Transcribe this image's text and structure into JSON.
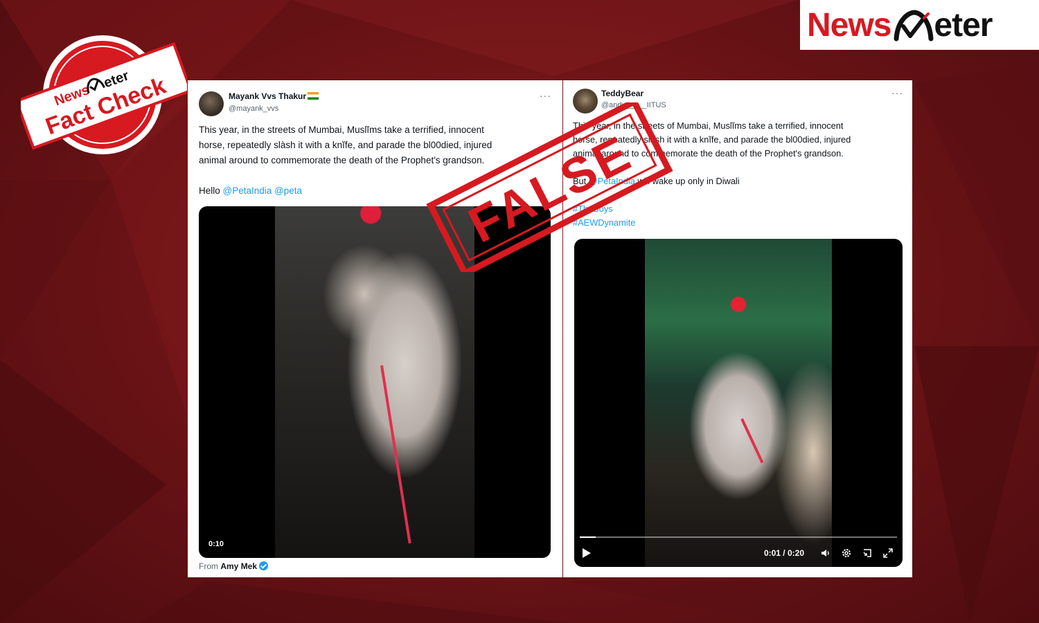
{
  "brand": {
    "name_part1": "News",
    "name_part2": "eter",
    "accent_color": "#d71920"
  },
  "fact_check_stamp": {
    "brand": "NewsMeter",
    "label": "Fact Check",
    "color": "#d71920"
  },
  "verdict_stamp": {
    "label": "FALSE",
    "color": "#d71920"
  },
  "tweet_left": {
    "author_name": "Mayank Vvs Thakur",
    "author_flag_icon": "india-flag-icon",
    "author_handle": "@mayank_vvs",
    "more_label": "···",
    "text_line1": "This year, in the streets of Mumbai, Muslĭms take a terrified, innocent",
    "text_line2": "horse, repeatedly slàsh it with a knĭfe, and parade the bl00died, injured",
    "text_line3": "animal around to commemorate the death of the Prophet's grandson.",
    "hello_prefix": "Hello ",
    "mention1": "@PetaIndia",
    "mention2": "@peta",
    "video_time": "0:10",
    "from_prefix": "From ",
    "from_author": "Amy Mek"
  },
  "tweet_right": {
    "author_name": "TeddyBear",
    "author_handle": "@andy_____IITUS",
    "more_label": "···",
    "text_line1": "This year, in the streets of Mumbai, Muslĭms take a terrified, innocent",
    "text_line2": "horse, repeatedly slash it with a knĭfe, and parade the bl00died, injured",
    "text_line3": "animal around to commemorate the death of the Prophet's grandson.",
    "but_prefix": "But ",
    "mention": "@PetaIndia",
    "but_suffix": " will wake up only in Diwali",
    "hashtag1": "#TheBoys",
    "hashtag2": "#AEWDynamite",
    "video_time": "0:01 / 0:20",
    "video_progress": 0.05
  }
}
